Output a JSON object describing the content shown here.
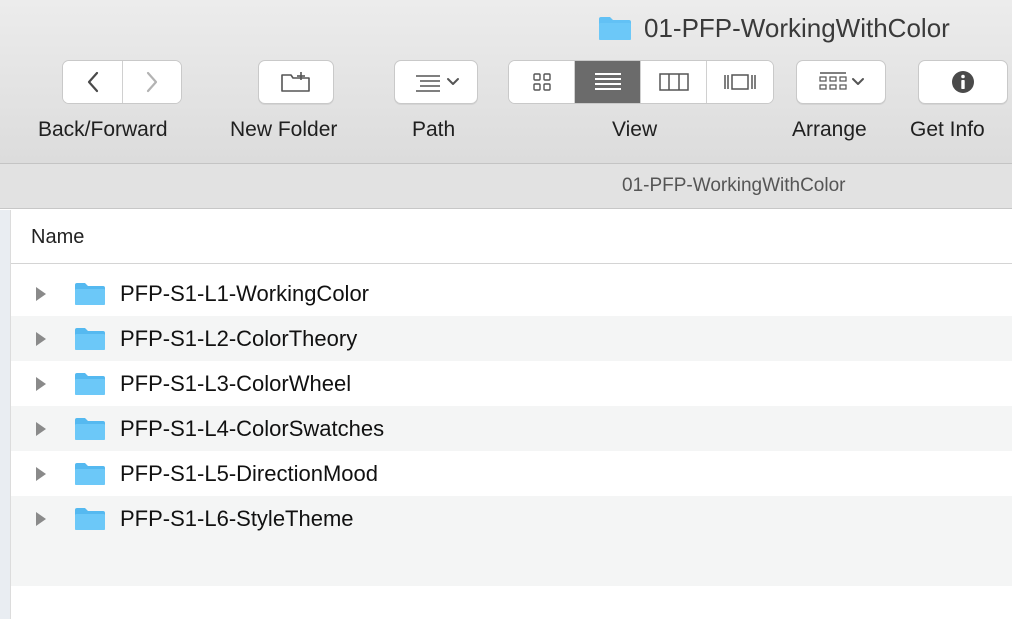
{
  "window": {
    "title": "01-PFP-WorkingWithColor"
  },
  "toolbar": {
    "back_forward_label": "Back/Forward",
    "new_folder_label": "New Folder",
    "path_label": "Path",
    "view_label": "View",
    "arrange_label": "Arrange",
    "get_info_label": "Get Info",
    "view_modes": [
      "icon-view",
      "list-view",
      "column-view",
      "cover-flow-view"
    ],
    "active_view": "list-view"
  },
  "pathbar": {
    "current": "01-PFP-WorkingWithColor"
  },
  "list": {
    "column_header": "Name",
    "items": [
      {
        "name": "PFP-S1-L1-WorkingColor"
      },
      {
        "name": "PFP-S1-L2-ColorTheory"
      },
      {
        "name": "PFP-S1-L3-ColorWheel"
      },
      {
        "name": "PFP-S1-L4-ColorSwatches"
      },
      {
        "name": "PFP-S1-L5-DirectionMood"
      },
      {
        "name": "PFP-S1-L6-StyleTheme"
      }
    ]
  },
  "colors": {
    "folder": "#62c1f5",
    "active_segment": "#6b6b6b",
    "toolbar_bg": "#e4e4e4"
  }
}
